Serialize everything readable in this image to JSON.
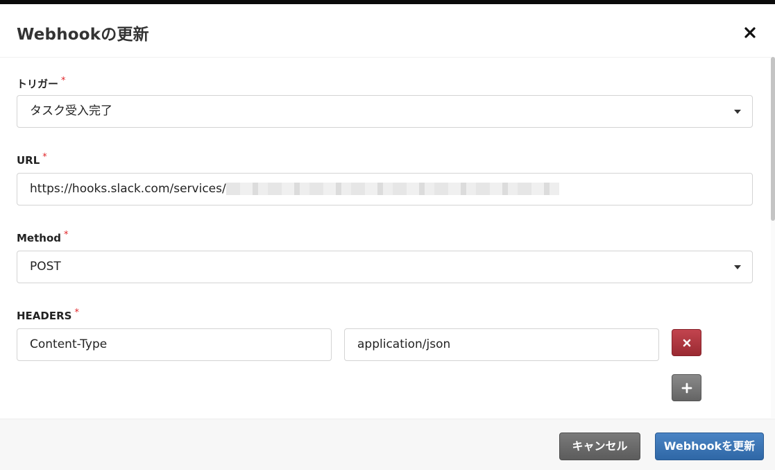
{
  "modal": {
    "title": "Webhookの更新"
  },
  "required_mark": "*",
  "trigger": {
    "label": "トリガー",
    "value": "タスク受入完了"
  },
  "url": {
    "label": "URL",
    "value": "https://hooks.slack.com/services/"
  },
  "method": {
    "label": "Method",
    "value": "POST"
  },
  "headers": {
    "label": "HEADERS",
    "rows": [
      {
        "key": "Content-Type",
        "value": "application/json"
      }
    ]
  },
  "footer": {
    "cancel_label": "キャンセル",
    "submit_label": "Webhookを更新"
  },
  "icons": {
    "close": "close-icon",
    "remove": "times-icon",
    "add": "plus-icon",
    "dropdown": "caret-down-icon"
  },
  "colors": {
    "danger": "#a8313a",
    "primary": "#3a72b3",
    "secondary": "#6b6b6b",
    "required": "#e0262a"
  }
}
